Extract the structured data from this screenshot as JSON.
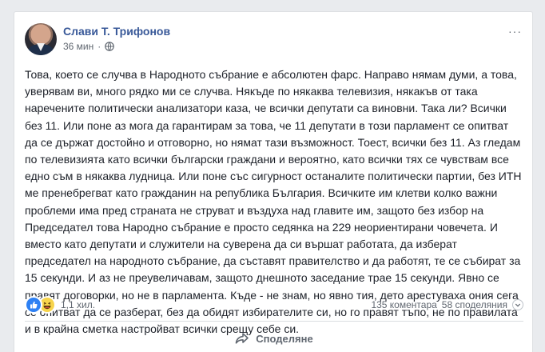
{
  "post": {
    "author": "Слави Т. Трифонов",
    "time": "36 мин",
    "dots": "···",
    "text": "Това, което се случва в Народното събрание е абсолютен фарс. Направо нямам думи, а това, уверявам ви, много рядко ми се случва. Някъде по някаква телевизия, някакъв от така наречените политически анализатори каза, че всички депутати са виновни. Така ли? Всички без 11. Или поне аз мога да гарантирам за това, че 11 депутати в този парламент се опитват да се държат достойно и отговорно, но нямат тази възможност. Тоест, всички без 11. Аз гледам по телевизията като всички български граждани и вероятно, като всички тях се чувствам все едно съм в някаква лудница. Или поне със сигурност останалите политически партии, без ИТН ме пренебрегват като гражданин на република България. Всичките им клетви колко важни проблеми има пред страната не струват и въздуха над главите им, защото без избор на Председател това Народно събрание е просто седянка на 229 неориентирани човечета. И вместо като депутати и служители на суверена да си вършат работата, да изберат председател на народното събрание, да съставят правителство и да работят, те се събират за 15 секунди. И аз не преувеличавам, защото днешното заседание трае 15 секунди. Явно се правят договорки, но не в парламента. Къде - не знам, но явно тия, дето арестуваха ония сега се опитват да се разберат, без да обидят избирателите си, но го правят тъпо, не по правилата и в крайна сметка настройват всички срещу себе си."
  },
  "stats": {
    "reactions_count": "1,1 хил.",
    "comments": "135 коментара",
    "shares": "58 споделяния"
  },
  "actions": {
    "share_label": "Споделяне"
  },
  "colors": {
    "author_link": "#385898",
    "like_blue": "#2e81f4",
    "haha_yellow": "#f7d44b",
    "secondary_text": "#606770"
  }
}
